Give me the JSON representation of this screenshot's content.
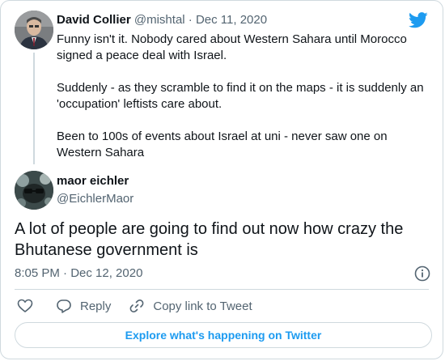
{
  "parent_tweet": {
    "author_name": "David Collier",
    "author_handle": "@mishtal",
    "separator": "·",
    "date": "Dec 11, 2020",
    "text": "Funny isn't it. Nobody cared about Western Sahara until Morocco signed a peace deal with Israel.\n\nSuddenly - as they scramble to find it on the maps - it is suddenly an 'occupation' leftists care about.\n\nBeen to 100s of events about Israel at uni - never saw one on Western Sahara"
  },
  "main_tweet": {
    "author_name": "maor eichler",
    "author_handle": "@EichlerMaor",
    "text": "A lot of people are going to find out now how crazy the Bhutanese government is",
    "timestamp": "8:05 PM · Dec 12, 2020"
  },
  "actions": {
    "reply_label": "Reply",
    "copy_link_label": "Copy link to Tweet"
  },
  "explore_label": "Explore what's happening on Twitter",
  "colors": {
    "brand_blue": "#1d9bf0",
    "muted_text": "#536471",
    "border": "#cfd9de"
  },
  "icons": [
    "twitter-bird-icon",
    "info-icon",
    "heart-icon",
    "reply-icon",
    "link-icon"
  ]
}
